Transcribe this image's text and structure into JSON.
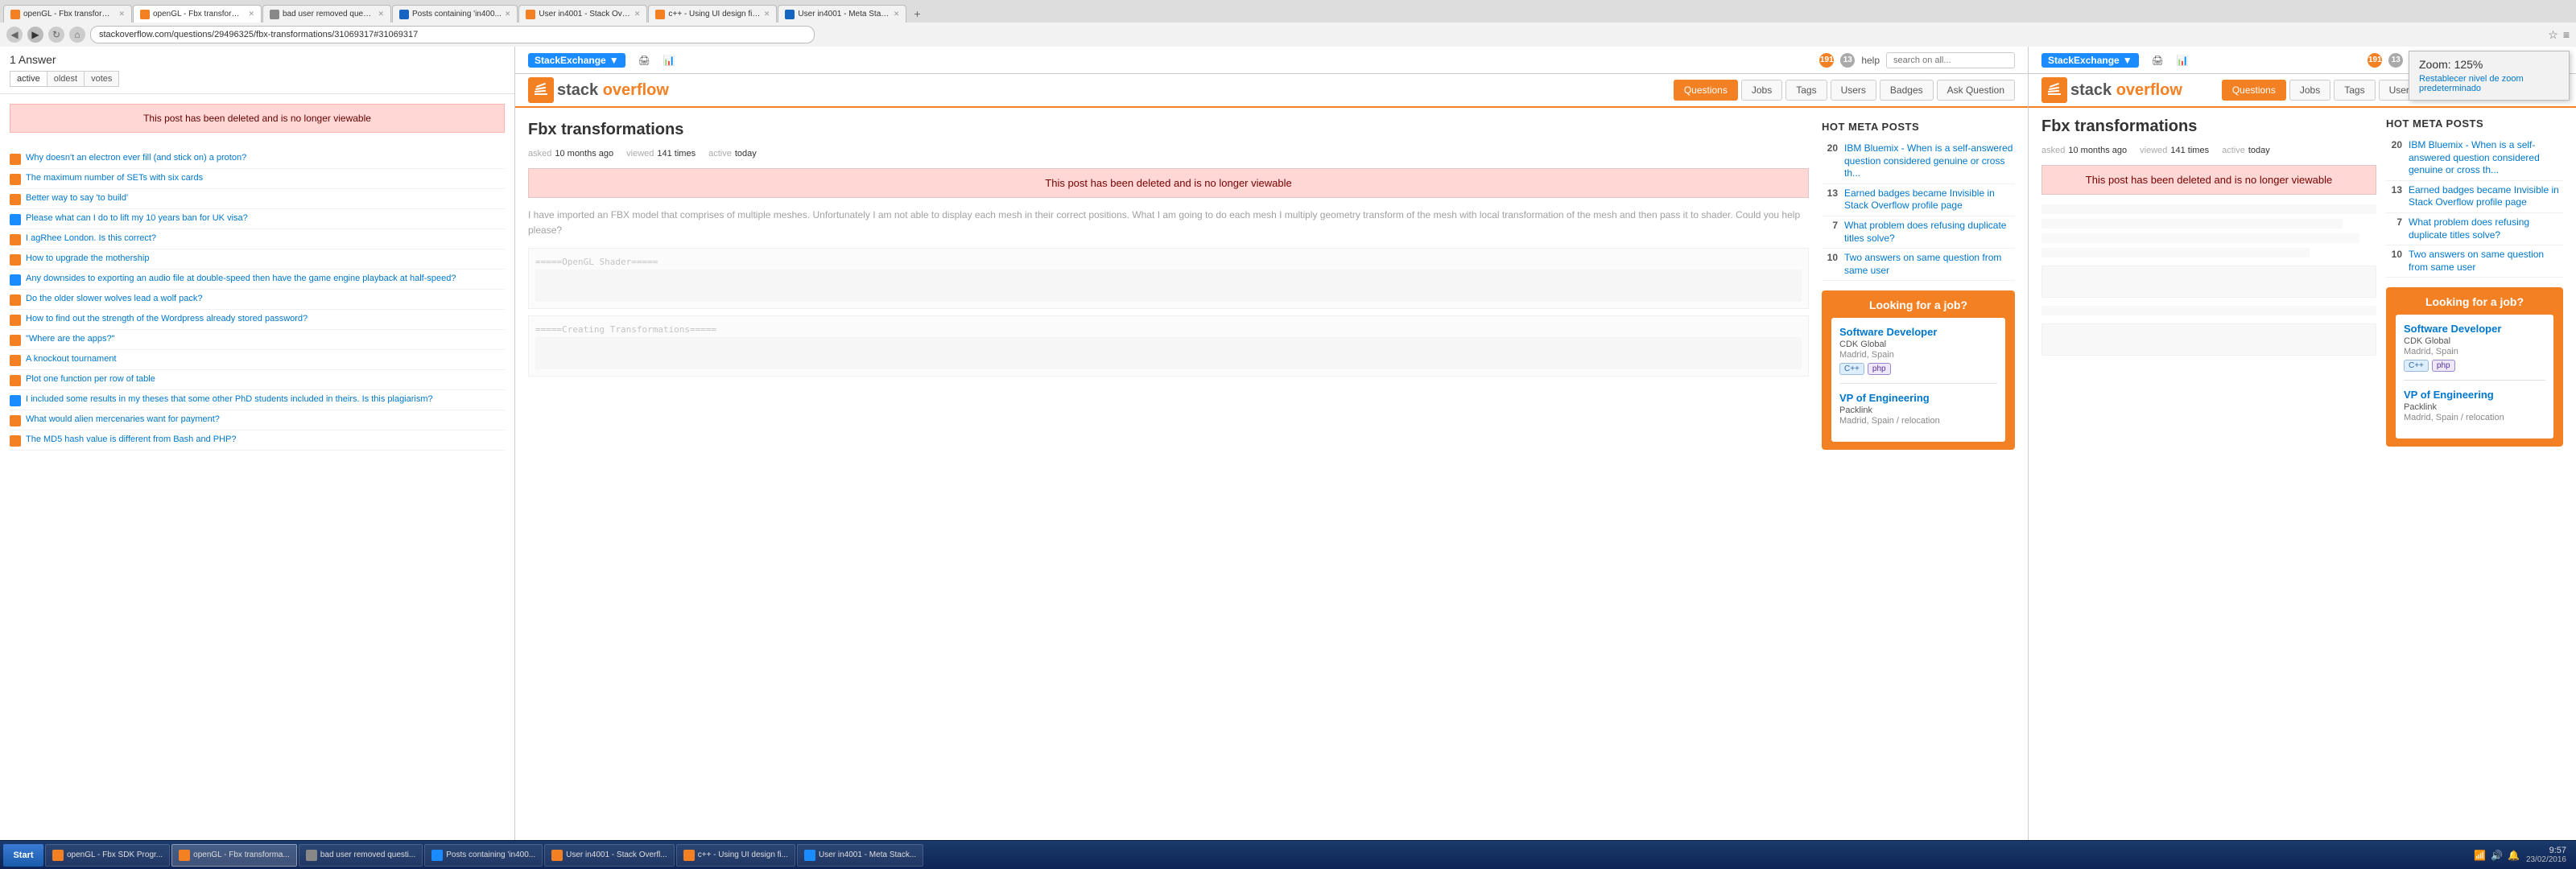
{
  "browser": {
    "tabs": [
      {
        "id": "tab-fbx-sdk1",
        "label": "openGL - Fbx transforma...",
        "favicon": "orange",
        "active": false
      },
      {
        "id": "tab-fbx-sdk2",
        "label": "openGL - Fbx transforma...",
        "favicon": "orange",
        "active": true
      },
      {
        "id": "tab-bad-user",
        "label": "bad user removed questi...",
        "favicon": "gray",
        "active": false
      },
      {
        "id": "tab-posts-in400",
        "label": "Posts containing 'in400...",
        "favicon": "blue",
        "active": false
      },
      {
        "id": "tab-user-in4001",
        "label": "User in4001 - Stack Overfl...",
        "favicon": "orange",
        "active": false
      },
      {
        "id": "tab-cpp-using",
        "label": "c++ - Using UI design fil...",
        "favicon": "orange",
        "active": false
      },
      {
        "id": "tab-user-meta",
        "label": "User in4001 - Meta Stack...",
        "favicon": "blue",
        "active": false
      }
    ],
    "address": "stackoverflow.com/questions/29496325/fbx-transformations/31069317#31069317",
    "left_address": "questions/29496325/fbx-transformations/31069317#31069317"
  },
  "zoom_popup": {
    "title": "Zoom: 125%",
    "reset_label": "Restablecer nivel de zoom predeterminado"
  },
  "left_panel": {
    "answers_count": "1 Answer",
    "tabs": [
      "active",
      "oldest",
      "votes"
    ],
    "deleted_message": "This post has been deleted and is no longer viewable",
    "questions": [
      {
        "id": "q1",
        "favicon": "so",
        "text": "Why doesn't an electron ever fill (and stick on) a proton?"
      },
      {
        "id": "q2",
        "favicon": "so",
        "text": "The maximum number of SETs with six cards"
      },
      {
        "id": "q3",
        "favicon": "so",
        "text": "Better way to say 'to build'"
      },
      {
        "id": "q4",
        "favicon": "se",
        "text": "Please what can I do to lift my 10 years ban for UK visa?"
      },
      {
        "id": "q5",
        "favicon": "so",
        "text": "I agRhee London. Is this correct?"
      },
      {
        "id": "q6",
        "favicon": "so",
        "text": "How to upgrade the mothership"
      },
      {
        "id": "q7",
        "favicon": "so",
        "text": "Any downsides to exporting an audio file at double-speed then have the game engine playback at half-speed?"
      },
      {
        "id": "q8",
        "favicon": "se",
        "text": "Do the older slower wolves lead a wolf pack?"
      },
      {
        "id": "q9",
        "favicon": "so",
        "text": "How to find out the strength of the Wordpress already stored password?"
      },
      {
        "id": "q10",
        "favicon": "so",
        "text": "\"Where are the apps?\""
      },
      {
        "id": "q11",
        "favicon": "so",
        "text": "A knockout tournament"
      },
      {
        "id": "q12",
        "favicon": "so",
        "text": "Plot one function per row of table"
      },
      {
        "id": "q13",
        "favicon": "so",
        "text": "I included some results in my theses that some other PhD students included in theirs. Is this plagiarism?"
      },
      {
        "id": "q14",
        "favicon": "so",
        "text": "What would alien mercenaries want for payment?"
      },
      {
        "id": "q15",
        "favicon": "so",
        "text": "The MD5 hash value is different from Bash and PHP?"
      }
    ]
  },
  "middle_panel": {
    "stackexchange": {
      "logo": "StackExchange",
      "inbox_count": "191",
      "rep_count": "13",
      "help_label": "help",
      "search_placeholder": "search on all..."
    },
    "so_logo": "stack overflow",
    "nav_items": [
      "Questions",
      "Jobs",
      "Tags",
      "Users",
      "Badges",
      "Ask Question"
    ],
    "question": {
      "title": "Fbx transformations",
      "asked_label": "asked",
      "asked_value": "10 months ago",
      "viewed_label": "viewed",
      "viewed_value": "141 times",
      "active_label": "active",
      "active_value": "today"
    },
    "deleted_message": "This post has been deleted and is no longer viewable",
    "body_text": "I have imported an FBX model that comprises of multiple meshes. Unfortunately I am not able to display each mesh in their correct positions. What I am going to do each mesh I multiply geometry transform of the mesh with local transformation of the mesh and then pass it to shader. Could you help please?",
    "code_label1": "=====OpenGL Shader=====",
    "code_label2": "=====Creating Transformations=====",
    "hot_meta": {
      "title": "HOT META POSTS",
      "items": [
        {
          "count": "20",
          "text": "IBM Bluemix - When is a self-answered question considered genuine or cross th..."
        },
        {
          "count": "13",
          "text": "Earned badges became Invisible in Stack Overflow profile page"
        },
        {
          "count": "7",
          "text": "What problem does refusing duplicate titles solve?"
        },
        {
          "count": "10",
          "text": "Two answers on same question from same user"
        }
      ]
    },
    "job_box": {
      "title": "Looking for a job?",
      "jobs": [
        {
          "title": "Software Developer",
          "company": "CDK Global",
          "location": "Madrid, Spain",
          "tags": [
            "C++",
            "php"
          ]
        },
        {
          "title": "VP of Engineering",
          "company": "Packlink",
          "location": "Madrid, Spain / relocation",
          "tags": []
        }
      ]
    }
  },
  "right_panel": {
    "question_title": "Fbx transformations",
    "meta": {
      "asked_label": "asked",
      "asked_value": "10 months ago",
      "viewed_label": "viewed",
      "viewed_value": "141 times",
      "active_label": "active",
      "active_value": "today"
    },
    "deleted_message": "This post has been deleted and is no longer viewable",
    "hot_meta_title": "HOT META POSTS",
    "hot_items": [
      {
        "count": "20",
        "text": "IBM Bluemix - When is a self-answered question considered genuine or cross th..."
      },
      {
        "count": "13",
        "text": "Earned badges became Invisible in Stack Overflow profile page"
      },
      {
        "count": "7",
        "text": "What problem does refusing duplicate titles solve?"
      },
      {
        "count": "10",
        "text": "Two answers on same question from same user"
      }
    ],
    "job_title": "Looking for a job?",
    "jobs": [
      {
        "title": "Software Developer",
        "company": "CDK Global",
        "location": "Madrid, Spain",
        "tags": [
          "C++",
          "php"
        ]
      },
      {
        "title": "VP of Engineering",
        "company": "Packlink",
        "location": "Madrid, Spain / relocation",
        "tags": []
      }
    ]
  },
  "taskbar": {
    "start_label": "Start",
    "buttons": [
      {
        "id": "t1",
        "label": "openGL - Fbx SDK Progr...",
        "active": false
      },
      {
        "id": "t2",
        "label": "openGL - Fbx transforma...",
        "active": true
      },
      {
        "id": "t3",
        "label": "bad user removed questi...",
        "active": false
      },
      {
        "id": "t4",
        "label": "Posts containing 'in400...",
        "active": false
      },
      {
        "id": "t5",
        "label": "User in4001 - Stack Overfl...",
        "active": false
      },
      {
        "id": "t6",
        "label": "c++ - Using UI design fi...",
        "active": false
      },
      {
        "id": "t7",
        "label": "User in4001 - Meta Stack...",
        "active": false
      }
    ],
    "clock_time": "9:57",
    "clock_date": "23/02/2016"
  }
}
